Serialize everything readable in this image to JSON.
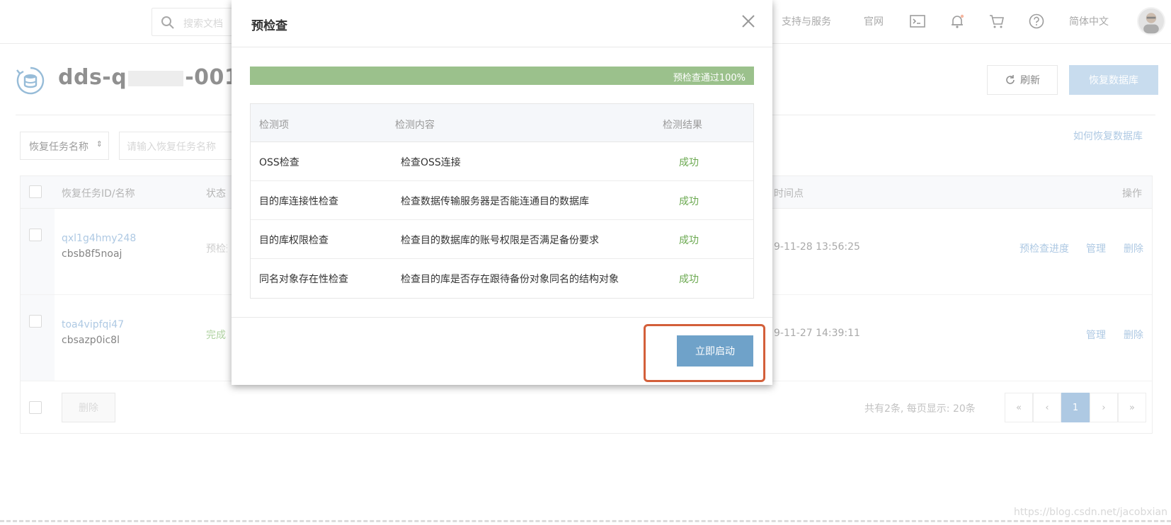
{
  "topbar": {
    "search_placeholder": "搜索文档",
    "links": [
      "支持与服务",
      "官网"
    ],
    "language": "简体中文"
  },
  "header": {
    "instance_title": "dds-q",
    "instance_title_suffix": "-001",
    "refresh_label": "刷新",
    "restore_label": "恢复数据库",
    "help_link": "如何恢复数据库"
  },
  "filter": {
    "select_value": "恢复任务名称",
    "input_placeholder": "请输入恢复任务名称"
  },
  "table": {
    "columns": [
      "恢复任务ID/名称",
      "状态",
      "时间点",
      "操作"
    ],
    "rows": [
      {
        "id": "qxl1g4hmy248",
        "name": "cbsb8f5noaj",
        "status": "预检查",
        "time": "9-11-28 13:56:25",
        "ops": [
          "预检查进度",
          "管理",
          "删除"
        ]
      },
      {
        "id": "toa4vipfqi47",
        "name": "cbsazp0ic8l",
        "status": "完成",
        "time": "9-11-27 14:39:11",
        "ops": [
          "管理",
          "删除"
        ]
      }
    ],
    "delete_label": "删除",
    "pagination_info": "共有2条, 每页显示: 20条",
    "pages": [
      "«",
      "‹",
      "1",
      "›",
      "»"
    ],
    "current_page": "1"
  },
  "modal": {
    "title": "预检查",
    "progress_text": "预检查通过100%",
    "progress_percent": 100,
    "columns": [
      "检测项",
      "检测内容",
      "检测结果"
    ],
    "rows": [
      {
        "item": "OSS检查",
        "content": "检查OSS连接",
        "result": "成功"
      },
      {
        "item": "目的库连接性检查",
        "content": "检查数据传输服务器是否能连通目的数据库",
        "result": "成功"
      },
      {
        "item": "目的库权限检查",
        "content": "检查目的数据库的账号权限是否满足备份要求",
        "result": "成功"
      },
      {
        "item": "同名对象存在性检查",
        "content": "检查目的库是否存在跟待备份对象同名的结构对象",
        "result": "成功"
      }
    ],
    "start_label": "立即启动"
  },
  "watermark": "https://blog.csdn.net/jacobxian",
  "colors": {
    "accent": "#8fb4d9",
    "success": "#6aa84f",
    "progress": "#9bc18c",
    "highlight": "#d35f3a"
  }
}
